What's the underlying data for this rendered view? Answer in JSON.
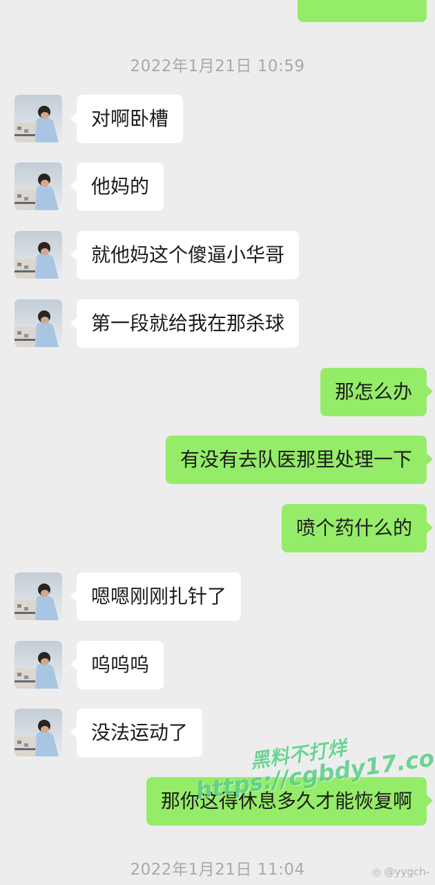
{
  "timestamps": {
    "first": "2022年1月21日 10:59",
    "second": "2022年1月21日 11:04"
  },
  "messages": [
    {
      "side": "in",
      "text": "对啊卧槽"
    },
    {
      "side": "in",
      "text": "他妈的"
    },
    {
      "side": "in",
      "text": "就他妈这个傻逼小华哥"
    },
    {
      "side": "in",
      "text": "第一段就给我在那杀球"
    },
    {
      "side": "out",
      "text": "那怎么办"
    },
    {
      "side": "out",
      "text": "有没有去队医那里处理一下"
    },
    {
      "side": "out",
      "text": "喷个药什么的"
    },
    {
      "side": "in",
      "text": "嗯嗯刚刚扎针了"
    },
    {
      "side": "in",
      "text": "呜呜呜"
    },
    {
      "side": "in",
      "text": "没法运动了"
    },
    {
      "side": "out",
      "text": "那你这得休息多久才能恢复啊"
    }
  ],
  "watermark": {
    "line1": "黑料不打烊",
    "line2": "https://cgbdy17.com",
    "weibo_handle": "@yygch-"
  },
  "colors": {
    "background": "#ededed",
    "incoming_bubble": "#ffffff",
    "outgoing_bubble": "#95ec69",
    "timestamp_text": "#a9a9a9"
  },
  "icons": {
    "avatar": "avatar-photo",
    "weibo": "weibo-icon"
  }
}
